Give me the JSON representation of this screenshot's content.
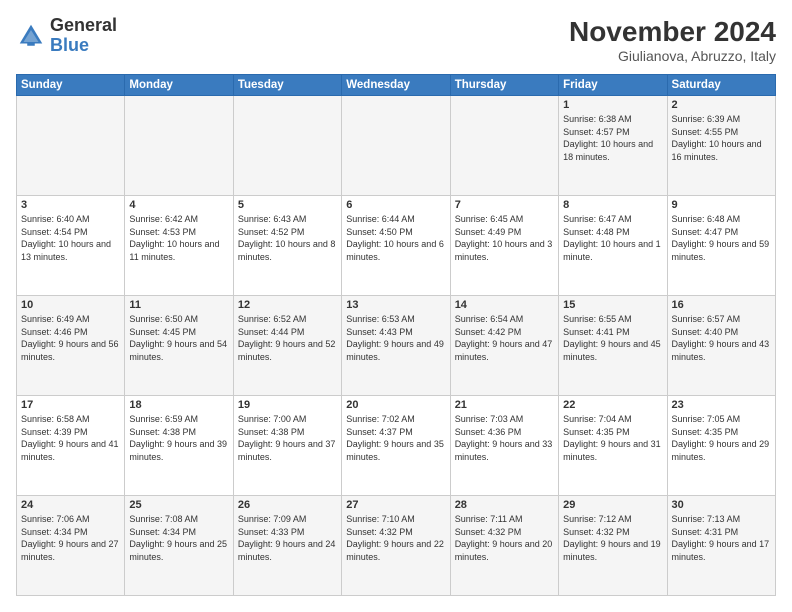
{
  "logo": {
    "text_general": "General",
    "text_blue": "Blue"
  },
  "header": {
    "month_year": "November 2024",
    "location": "Giulianova, Abruzzo, Italy"
  },
  "days_of_week": [
    "Sunday",
    "Monday",
    "Tuesday",
    "Wednesday",
    "Thursday",
    "Friday",
    "Saturday"
  ],
  "weeks": [
    [
      {
        "day": "",
        "info": ""
      },
      {
        "day": "",
        "info": ""
      },
      {
        "day": "",
        "info": ""
      },
      {
        "day": "",
        "info": ""
      },
      {
        "day": "",
        "info": ""
      },
      {
        "day": "1",
        "info": "Sunrise: 6:38 AM\nSunset: 4:57 PM\nDaylight: 10 hours and 18 minutes."
      },
      {
        "day": "2",
        "info": "Sunrise: 6:39 AM\nSunset: 4:55 PM\nDaylight: 10 hours and 16 minutes."
      }
    ],
    [
      {
        "day": "3",
        "info": "Sunrise: 6:40 AM\nSunset: 4:54 PM\nDaylight: 10 hours and 13 minutes."
      },
      {
        "day": "4",
        "info": "Sunrise: 6:42 AM\nSunset: 4:53 PM\nDaylight: 10 hours and 11 minutes."
      },
      {
        "day": "5",
        "info": "Sunrise: 6:43 AM\nSunset: 4:52 PM\nDaylight: 10 hours and 8 minutes."
      },
      {
        "day": "6",
        "info": "Sunrise: 6:44 AM\nSunset: 4:50 PM\nDaylight: 10 hours and 6 minutes."
      },
      {
        "day": "7",
        "info": "Sunrise: 6:45 AM\nSunset: 4:49 PM\nDaylight: 10 hours and 3 minutes."
      },
      {
        "day": "8",
        "info": "Sunrise: 6:47 AM\nSunset: 4:48 PM\nDaylight: 10 hours and 1 minute."
      },
      {
        "day": "9",
        "info": "Sunrise: 6:48 AM\nSunset: 4:47 PM\nDaylight: 9 hours and 59 minutes."
      }
    ],
    [
      {
        "day": "10",
        "info": "Sunrise: 6:49 AM\nSunset: 4:46 PM\nDaylight: 9 hours and 56 minutes."
      },
      {
        "day": "11",
        "info": "Sunrise: 6:50 AM\nSunset: 4:45 PM\nDaylight: 9 hours and 54 minutes."
      },
      {
        "day": "12",
        "info": "Sunrise: 6:52 AM\nSunset: 4:44 PM\nDaylight: 9 hours and 52 minutes."
      },
      {
        "day": "13",
        "info": "Sunrise: 6:53 AM\nSunset: 4:43 PM\nDaylight: 9 hours and 49 minutes."
      },
      {
        "day": "14",
        "info": "Sunrise: 6:54 AM\nSunset: 4:42 PM\nDaylight: 9 hours and 47 minutes."
      },
      {
        "day": "15",
        "info": "Sunrise: 6:55 AM\nSunset: 4:41 PM\nDaylight: 9 hours and 45 minutes."
      },
      {
        "day": "16",
        "info": "Sunrise: 6:57 AM\nSunset: 4:40 PM\nDaylight: 9 hours and 43 minutes."
      }
    ],
    [
      {
        "day": "17",
        "info": "Sunrise: 6:58 AM\nSunset: 4:39 PM\nDaylight: 9 hours and 41 minutes."
      },
      {
        "day": "18",
        "info": "Sunrise: 6:59 AM\nSunset: 4:38 PM\nDaylight: 9 hours and 39 minutes."
      },
      {
        "day": "19",
        "info": "Sunrise: 7:00 AM\nSunset: 4:38 PM\nDaylight: 9 hours and 37 minutes."
      },
      {
        "day": "20",
        "info": "Sunrise: 7:02 AM\nSunset: 4:37 PM\nDaylight: 9 hours and 35 minutes."
      },
      {
        "day": "21",
        "info": "Sunrise: 7:03 AM\nSunset: 4:36 PM\nDaylight: 9 hours and 33 minutes."
      },
      {
        "day": "22",
        "info": "Sunrise: 7:04 AM\nSunset: 4:35 PM\nDaylight: 9 hours and 31 minutes."
      },
      {
        "day": "23",
        "info": "Sunrise: 7:05 AM\nSunset: 4:35 PM\nDaylight: 9 hours and 29 minutes."
      }
    ],
    [
      {
        "day": "24",
        "info": "Sunrise: 7:06 AM\nSunset: 4:34 PM\nDaylight: 9 hours and 27 minutes."
      },
      {
        "day": "25",
        "info": "Sunrise: 7:08 AM\nSunset: 4:34 PM\nDaylight: 9 hours and 25 minutes."
      },
      {
        "day": "26",
        "info": "Sunrise: 7:09 AM\nSunset: 4:33 PM\nDaylight: 9 hours and 24 minutes."
      },
      {
        "day": "27",
        "info": "Sunrise: 7:10 AM\nSunset: 4:32 PM\nDaylight: 9 hours and 22 minutes."
      },
      {
        "day": "28",
        "info": "Sunrise: 7:11 AM\nSunset: 4:32 PM\nDaylight: 9 hours and 20 minutes."
      },
      {
        "day": "29",
        "info": "Sunrise: 7:12 AM\nSunset: 4:32 PM\nDaylight: 9 hours and 19 minutes."
      },
      {
        "day": "30",
        "info": "Sunrise: 7:13 AM\nSunset: 4:31 PM\nDaylight: 9 hours and 17 minutes."
      }
    ]
  ]
}
